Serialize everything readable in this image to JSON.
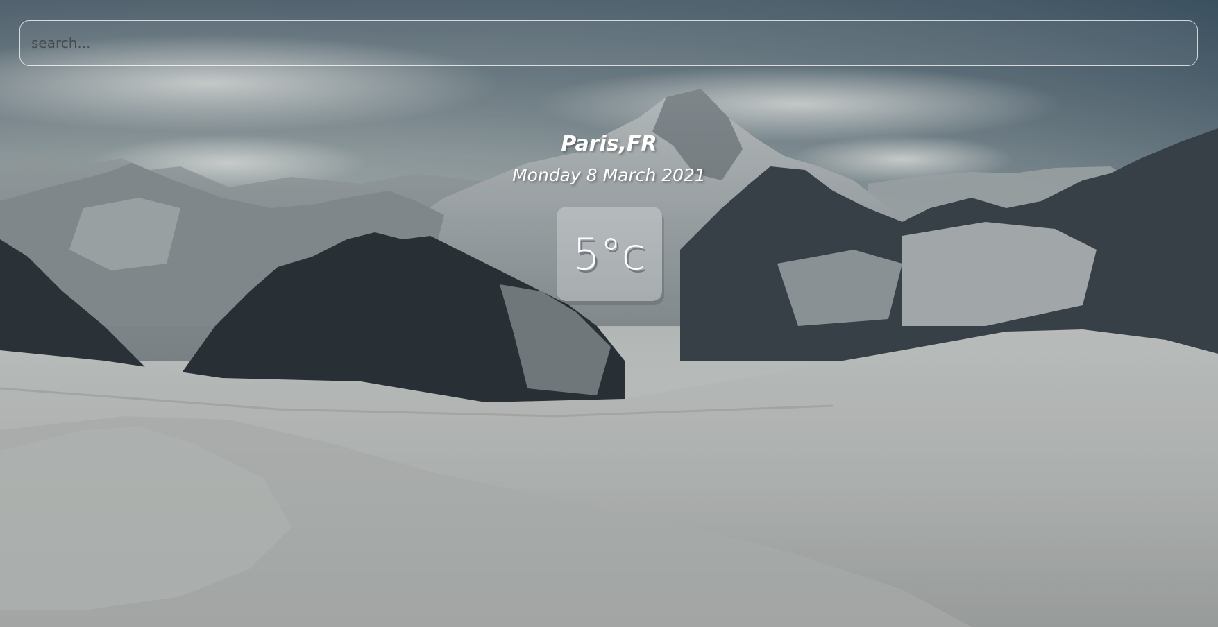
{
  "search": {
    "placeholder": "search...",
    "value": ""
  },
  "weather": {
    "location": "Paris,FR",
    "date": "Monday 8 March 2021",
    "temperature": "5°c"
  },
  "colors": {
    "text": "#ffffff",
    "sky": "#9aa6a8",
    "snow": "#d9dbd8",
    "rock": "#2c3338"
  }
}
